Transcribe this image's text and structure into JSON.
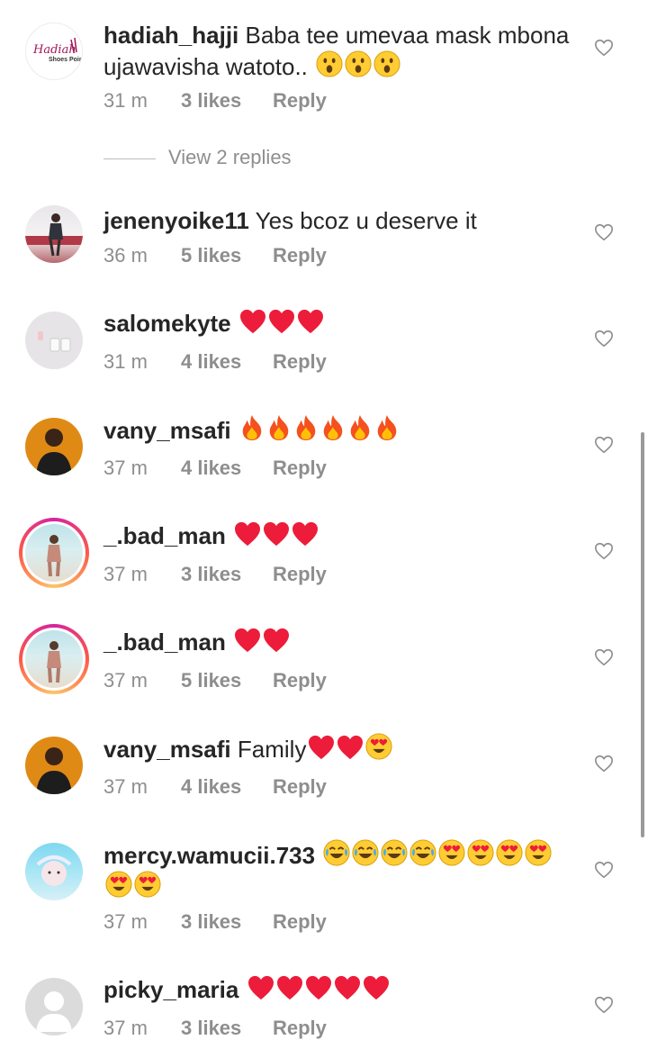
{
  "view_replies_label": "View 2 replies",
  "comments": [
    {
      "username": "hadiah_hajji",
      "text": "Baba tee umevaa mask mbona ujawavisha watoto..",
      "time": "31 m",
      "likes": "3 likes",
      "reply": "Reply",
      "avatar_label": "Hadiah Shoes Point"
    },
    {
      "username": "jenenyoike11",
      "text": "Yes bcoz u deserve it",
      "time": "36 m",
      "likes": "5 likes",
      "reply": "Reply"
    },
    {
      "username": "salomekyte",
      "text": "",
      "time": "31 m",
      "likes": "4 likes",
      "reply": "Reply"
    },
    {
      "username": "vany_msafi",
      "text": "",
      "time": "37 m",
      "likes": "4 likes",
      "reply": "Reply"
    },
    {
      "username": "_.bad_man",
      "text": "",
      "time": "37 m",
      "likes": "3 likes",
      "reply": "Reply"
    },
    {
      "username": "_.bad_man",
      "text": "",
      "time": "37 m",
      "likes": "5 likes",
      "reply": "Reply"
    },
    {
      "username": "vany_msafi",
      "text": "Family",
      "time": "37 m",
      "likes": "4 likes",
      "reply": "Reply"
    },
    {
      "username": "mercy.wamucii.733",
      "text": "",
      "time": "37 m",
      "likes": "3 likes",
      "reply": "Reply"
    },
    {
      "username": "picky_maria",
      "text": "",
      "time": "37 m",
      "likes": "3 likes",
      "reply": "Reply"
    }
  ],
  "colors": {
    "heart": "#ed1c3a",
    "fire": "#f4511e",
    "emoji_face": "#ffcc33",
    "muted_text": "#8e8e8e"
  }
}
